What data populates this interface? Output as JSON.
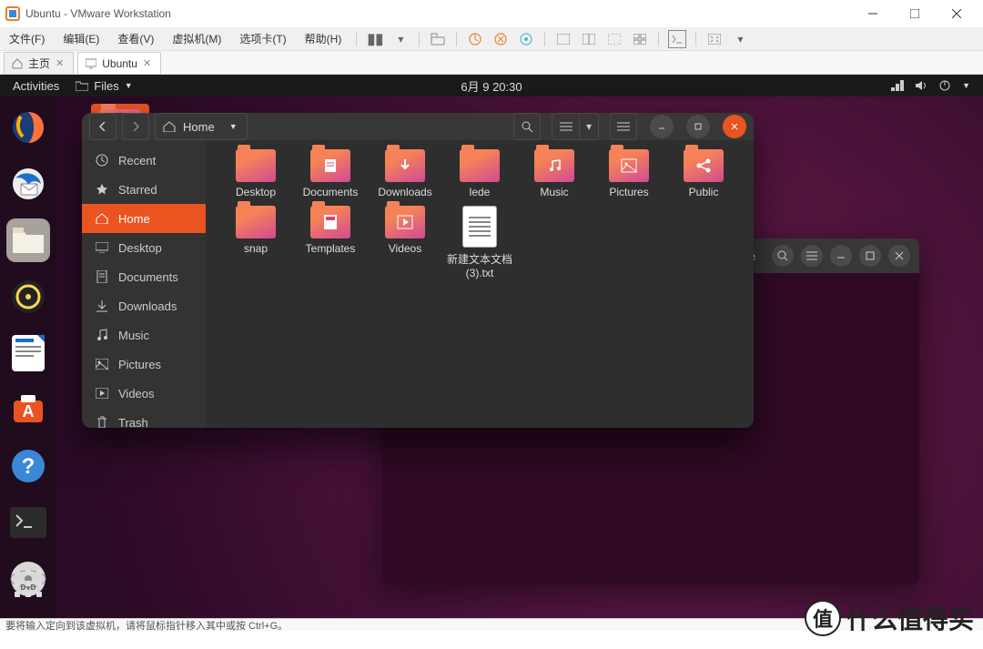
{
  "host": {
    "title": "Ubuntu - VMware Workstation",
    "menus": [
      "文件(F)",
      "编辑(E)",
      "查看(V)",
      "虚拟机(M)",
      "选项卡(T)",
      "帮助(H)"
    ],
    "tabs": [
      {
        "label": "主页",
        "icon": "home"
      },
      {
        "label": "Ubuntu",
        "icon": "monitor"
      }
    ],
    "status": "要将输入定向到该虚拟机，请将鼠标指针移入其中或按 Ctrl+G。"
  },
  "ubuntu": {
    "topbar": {
      "activities": "Activities",
      "app": "Files",
      "clock": "6月 9  20:30"
    },
    "dock": [
      {
        "name": "firefox",
        "color": "#ff7139"
      },
      {
        "name": "thunderbird",
        "color": "#1f6fd0"
      },
      {
        "name": "files",
        "color": "#ddd6c9",
        "active": true
      },
      {
        "name": "rhythmbox",
        "color": "#222"
      },
      {
        "name": "libreoffice-writer",
        "color": "#1a6fbf"
      },
      {
        "name": "software",
        "color": "#e95420"
      },
      {
        "name": "help",
        "color": "#3a87d8"
      },
      {
        "name": "terminal",
        "color": "#2b2b2b"
      },
      {
        "name": "disk",
        "color": "#ccc"
      }
    ]
  },
  "files": {
    "breadcrumb": "Home",
    "sidebar": [
      {
        "icon": "clock",
        "label": "Recent"
      },
      {
        "icon": "star",
        "label": "Starred"
      },
      {
        "icon": "home",
        "label": "Home",
        "active": true
      },
      {
        "icon": "monitor",
        "label": "Desktop"
      },
      {
        "icon": "doc",
        "label": "Documents"
      },
      {
        "icon": "download",
        "label": "Downloads"
      },
      {
        "icon": "music",
        "label": "Music"
      },
      {
        "icon": "image",
        "label": "Pictures"
      },
      {
        "icon": "video",
        "label": "Videos"
      },
      {
        "icon": "trash",
        "label": "Trash"
      }
    ],
    "items": [
      {
        "type": "folder",
        "icon": "",
        "label": "Desktop"
      },
      {
        "type": "folder",
        "icon": "doc",
        "label": "Documents"
      },
      {
        "type": "folder",
        "icon": "download",
        "label": "Downloads"
      },
      {
        "type": "folder",
        "icon": "",
        "label": "lede"
      },
      {
        "type": "folder",
        "icon": "music",
        "label": "Music"
      },
      {
        "type": "folder",
        "icon": "image",
        "label": "Pictures"
      },
      {
        "type": "folder",
        "icon": "share",
        "label": "Public"
      },
      {
        "type": "folder",
        "icon": "",
        "label": "snap"
      },
      {
        "type": "folder",
        "icon": "template",
        "label": "Templates"
      },
      {
        "type": "folder",
        "icon": "video",
        "label": "Videos"
      },
      {
        "type": "txt",
        "icon": "",
        "label": "新建文本文档 (3).txt"
      }
    ]
  },
  "bg_terminal": {
    "title_suffix": "e"
  },
  "watermark": "什么值得买"
}
